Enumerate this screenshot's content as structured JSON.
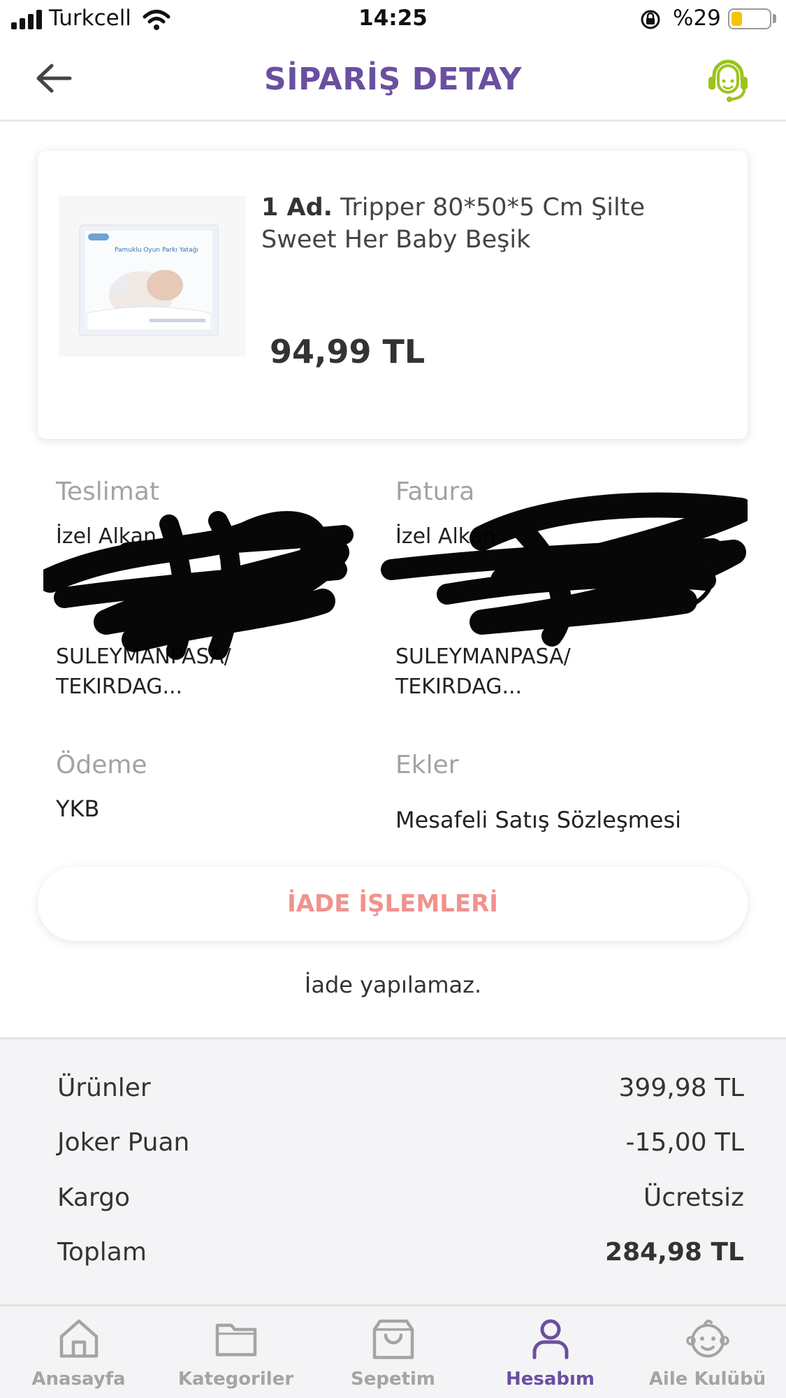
{
  "status_bar": {
    "carrier": "Turkcell",
    "time": "14:25",
    "battery": "%29",
    "battery_level": 0.29
  },
  "header": {
    "title": "SİPARİŞ DETAY",
    "back_icon": "arrow-left-icon",
    "support_icon": "headset-support-icon",
    "accent_color": "#6a4fa0",
    "support_color": "#9bc31c"
  },
  "product": {
    "quantity": "1 Ad.",
    "name": "Tripper 80*50*5 Cm Şilte Sweet Her Baby Beşik",
    "price": "94,99 TL",
    "thumbnail_text": "Pamuklu Oyun Parkı Yatağı"
  },
  "teslimat": {
    "label": "Teslimat",
    "lines": [
      "İzel Alkan",
      "",
      "",
      "",
      "SULEYMANPASA/",
      "TEKIRDAG..."
    ]
  },
  "fatura": {
    "label": "Fatura",
    "lines": [
      "İzel Alkan",
      "",
      "",
      "",
      "SULEYMANPASA/",
      "TEKIRDAG..."
    ]
  },
  "odeme": {
    "label": "Ödeme",
    "value": "YKB"
  },
  "ekler": {
    "label": "Ekler",
    "value": "Mesafeli Satış Sözleşmesi"
  },
  "iade": {
    "button_label": "İADE İŞLEMLERİ",
    "note": "İade yapılamaz.",
    "button_color": "#f0928e"
  },
  "summary": {
    "rows": [
      {
        "label": "Ürünler",
        "value": "399,98 TL"
      },
      {
        "label": "Joker Puan",
        "value": "-15,00 TL"
      },
      {
        "label": "Kargo",
        "value": "Ücretsiz"
      },
      {
        "label": "Toplam",
        "value": "284,98 TL"
      }
    ]
  },
  "tabbar": {
    "tabs": [
      {
        "label": "Anasayfa",
        "icon": "home-icon",
        "active": false
      },
      {
        "label": "Kategoriler",
        "icon": "folder-icon",
        "active": false
      },
      {
        "label": "Sepetim",
        "icon": "shopping-bag-icon",
        "active": false
      },
      {
        "label": "Hesabım",
        "icon": "user-icon",
        "active": true
      },
      {
        "label": "Aile Kulübü",
        "icon": "baby-face-icon",
        "active": false
      }
    ]
  }
}
